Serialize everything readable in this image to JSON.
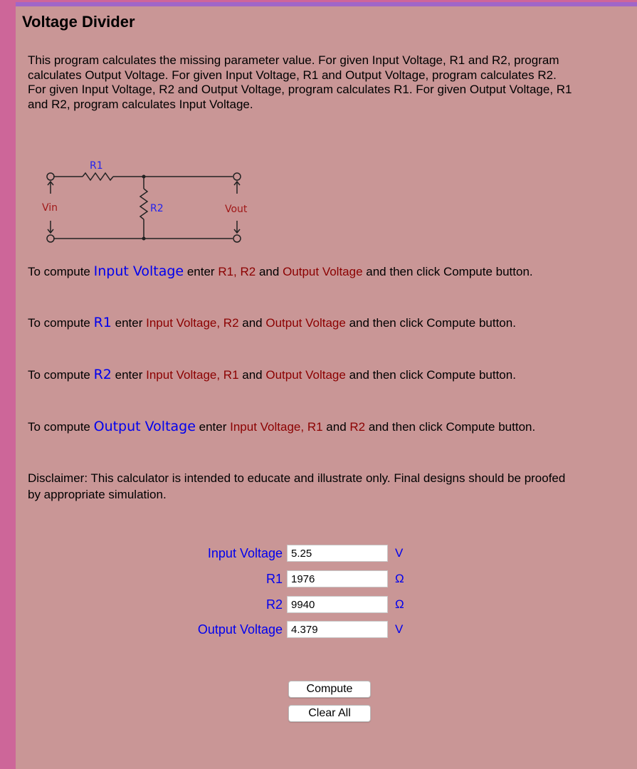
{
  "page": {
    "title": "Voltage Divider",
    "intro": "This program calculates the missing parameter value. For given Input Voltage, R1 and R2, program calculates Output Voltage. For given Input Voltage, R1 and Output Voltage, program calculates R2. For given Input Voltage, R2 and Output Voltage, program calculates R1. For given Output Voltage, R1 and R2, program calculates Input Voltage.",
    "colors": {
      "background_left_strip": "#cd6699",
      "top_bar": "#a066c8",
      "panel": "#c99696",
      "highlight_blue": "#0000ee",
      "highlight_red": "#8b0000"
    }
  },
  "circuit": {
    "r1_label": "R1",
    "r2_label": "R2",
    "vin_label": "Vin",
    "vout_label": "Vout"
  },
  "instructions": [
    {
      "prefix": "To compute ",
      "target": "Input Voltage",
      "mid": " enter ",
      "inputs_a": "R1, R2",
      "and": " and ",
      "inputs_b": "Output Voltage",
      "suffix": " and then click Compute button."
    },
    {
      "prefix": "To compute ",
      "target": "R1",
      "mid": " enter ",
      "inputs_a": "Input Voltage, R2",
      "and": " and ",
      "inputs_b": "Output Voltage",
      "suffix": " and then click Compute button."
    },
    {
      "prefix": "To compute ",
      "target": "R2",
      "mid": " enter ",
      "inputs_a": "Input Voltage, R1",
      "and": " and ",
      "inputs_b": "Output Voltage",
      "suffix": " and then click Compute button."
    },
    {
      "prefix": "To compute ",
      "target": "Output Voltage",
      "mid": " enter ",
      "inputs_a": "Input Voltage, R1",
      "and": " and ",
      "inputs_b": "R2",
      "suffix": " and then click Compute button."
    }
  ],
  "disclaimer": "Disclaimer: This calculator is intended to educate and illustrate only. Final designs should be proofed by appropriate simulation.",
  "form": {
    "fields": [
      {
        "label": "Input Voltage",
        "value": "5.25",
        "unit": "V"
      },
      {
        "label": "R1",
        "value": "1976",
        "unit": "Ω"
      },
      {
        "label": "R2",
        "value": "9940",
        "unit": "Ω"
      },
      {
        "label": "Output Voltage",
        "value": "4.379",
        "unit": "V"
      }
    ],
    "compute_label": "Compute",
    "clear_label": "Clear All"
  }
}
